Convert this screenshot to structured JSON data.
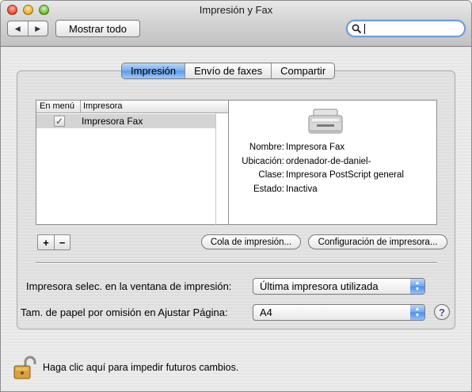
{
  "window": {
    "title": "Impresión y Fax"
  },
  "toolbar": {
    "back_glyph": "◀",
    "forward_glyph": "▶",
    "show_all_label": "Mostrar todo",
    "search_icon": "search-icon"
  },
  "tabs": [
    {
      "label": "Impresión",
      "selected": true
    },
    {
      "label": "Envío de faxes",
      "selected": false
    },
    {
      "label": "Compartir",
      "selected": false
    }
  ],
  "printer_list": {
    "columns": [
      "En menú",
      "Impresora"
    ],
    "rows": [
      {
        "in_menu": true,
        "check_glyph": "✓",
        "name": "Impresora Fax"
      }
    ]
  },
  "printer_info": {
    "icon": "printer-icon",
    "rows": [
      {
        "key": "Nombre:",
        "value": "Impresora Fax"
      },
      {
        "key": "Ubicación:",
        "value": "ordenador-de-daniel-"
      },
      {
        "key": "Clase:",
        "value": "Impresora PostScript general"
      },
      {
        "key": "Estado:",
        "value": "Inactiva"
      }
    ]
  },
  "list_buttons": {
    "add": "+",
    "remove": "−"
  },
  "actions": {
    "queue_label": "Cola de impresión...",
    "config_label": "Configuración de impresora..."
  },
  "settings": {
    "selected_printer_label": "Impresora selec. en la ventana de impresión:",
    "selected_printer_value": "Última impresora utilizada",
    "paper_size_label": "Tam. de papel por omisión en Ajustar Página:",
    "paper_size_value": "A4",
    "help_label": "?"
  },
  "footer": {
    "lock_text": "Haga clic aquí para impedir futuros cambios."
  },
  "colors": {
    "accent": "#5a99ea",
    "selection": "#d4d4d4"
  }
}
